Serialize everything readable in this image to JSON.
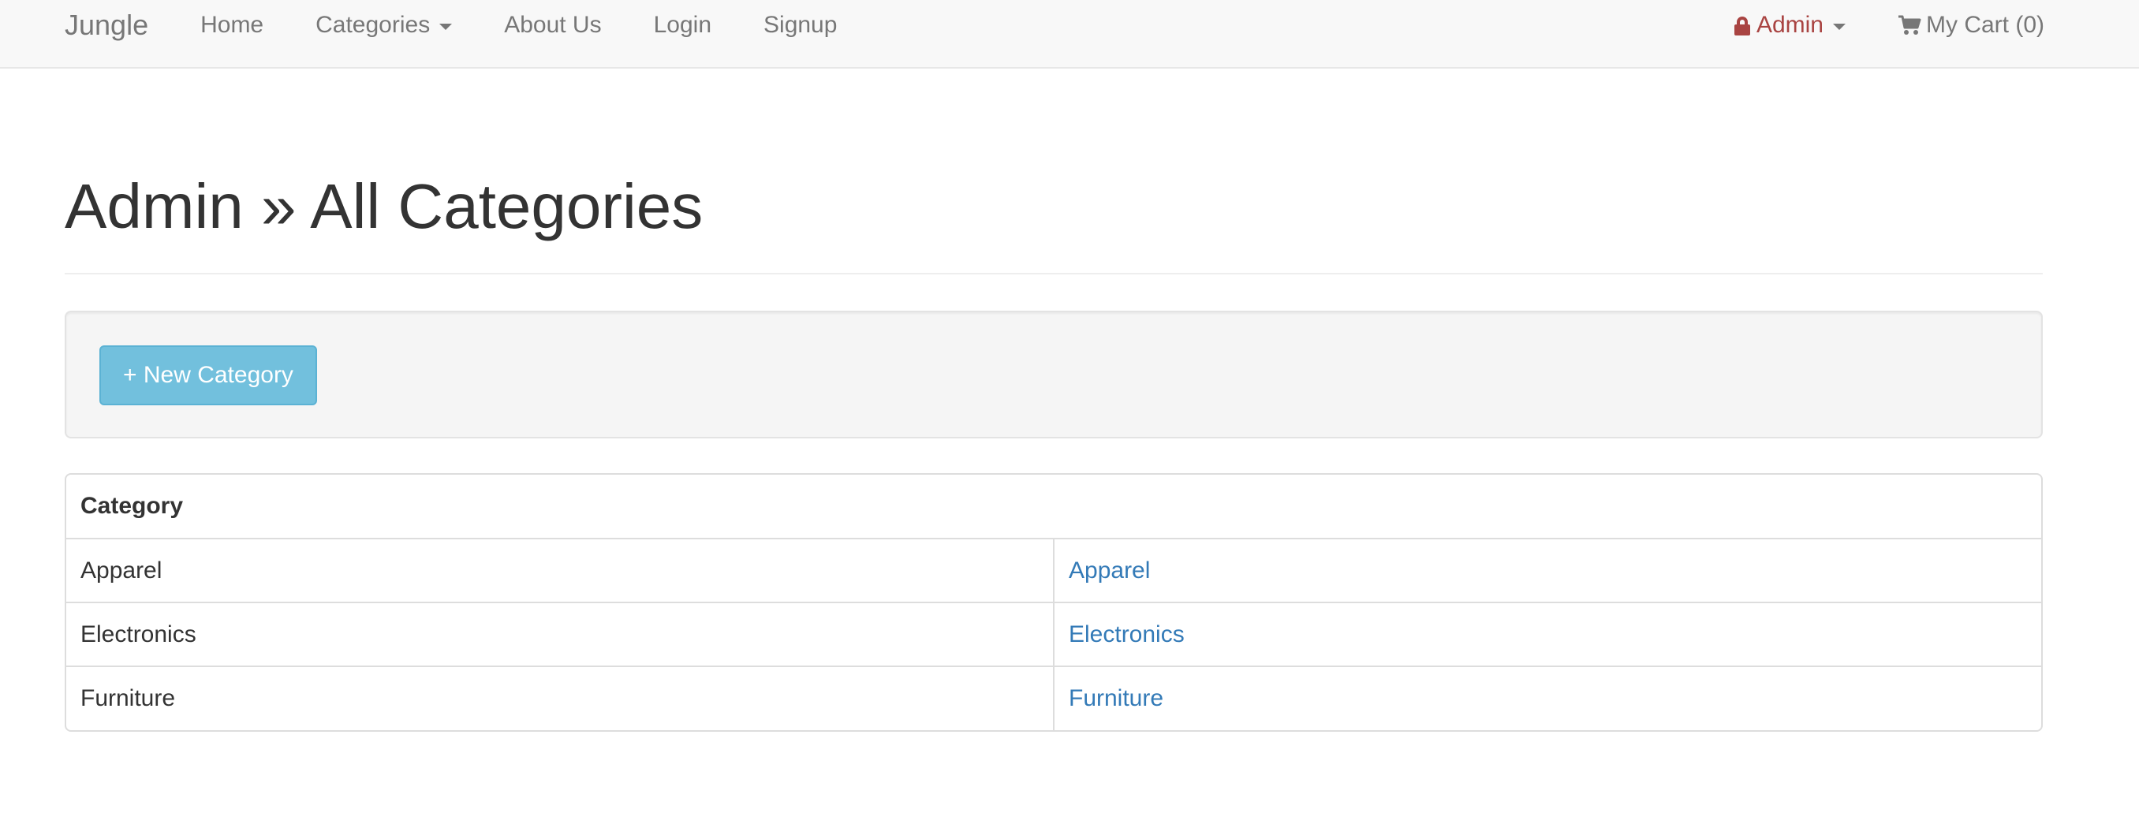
{
  "navbar": {
    "brand": "Jungle",
    "links": {
      "home": "Home",
      "categories": "Categories",
      "about": "About Us",
      "login": "Login",
      "signup": "Signup"
    },
    "admin": "Admin",
    "cart": "My Cart (0)",
    "colors": {
      "admin": "#a94442",
      "text": "#777777"
    },
    "icons": {
      "admin": "lock-icon",
      "cart": "shopping-cart-icon",
      "dropdown": "caret-down-icon"
    }
  },
  "page": {
    "title": "Admin » All Categories"
  },
  "actions": {
    "new_category": "+ New Category"
  },
  "table": {
    "header": "Category",
    "rows": [
      {
        "name": "Apparel",
        "link": "Apparel"
      },
      {
        "name": "Electronics",
        "link": "Electronics"
      },
      {
        "name": "Furniture",
        "link": "Furniture"
      }
    ],
    "link_color": "#337ab7"
  }
}
